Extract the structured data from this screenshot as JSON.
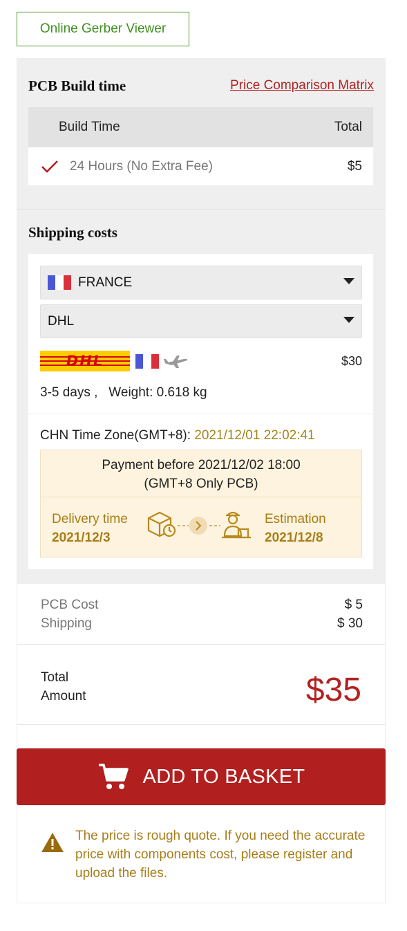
{
  "gerber_button": {
    "label": "Online Gerber Viewer"
  },
  "build_time": {
    "title": "PCB Build time",
    "price_link": "Price Comparison Matrix",
    "table": {
      "headers": {
        "build_time": "Build Time",
        "total": "Total"
      },
      "rows": [
        {
          "label": "24 Hours (No Extra Fee)",
          "price": "$5",
          "selected": true
        }
      ]
    }
  },
  "shipping": {
    "title": "Shipping costs",
    "country_select": {
      "value": "FRANCE",
      "flag": "france-flag-icon"
    },
    "carrier_select": {
      "value": "DHL"
    },
    "carrier": {
      "logo_text": "DHL",
      "price": "$30",
      "transit": "3-5 days ,",
      "weight": "Weight: 0.618 kg"
    },
    "timezone": {
      "label": "CHN Time Zone(GMT+8): ",
      "value": "2021/12/01 22:02:41"
    },
    "payment": {
      "line1": "Payment before 2021/12/02 18:00",
      "line2": "(GMT+8 Only PCB)",
      "delivery_label": "Delivery time",
      "delivery_date": "2021/12/3",
      "estimation_label": "Estimation",
      "estimation_date": "2021/12/8"
    }
  },
  "costs": {
    "pcb_label": "PCB Cost",
    "pcb_value": "$ 5",
    "shipping_label": "Shipping",
    "shipping_value": "$ 30"
  },
  "total": {
    "label_line1": "Total",
    "label_line2": "Amount",
    "amount": "$35"
  },
  "basket_button": {
    "label": "ADD TO BASKET"
  },
  "notice": {
    "text": "The price is rough quote. If you need the accurate price with components cost, please register and upload the files."
  },
  "colors": {
    "brand_red": "#b11f1f",
    "accent_gold": "#a77d17",
    "green": "#3f8f1f"
  }
}
